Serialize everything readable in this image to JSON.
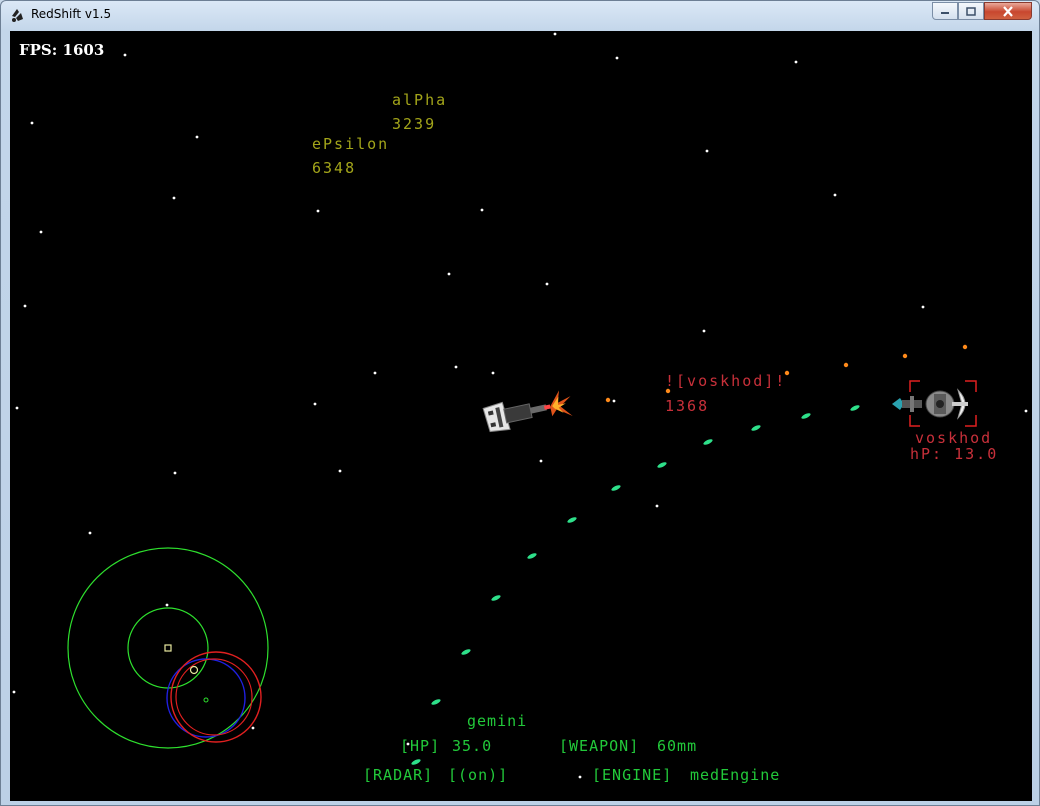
{
  "window": {
    "title": "RedShift v1.5"
  },
  "hud": {
    "fps_label": "FPS: 1603",
    "planets": [
      {
        "name": "alPha",
        "distance": "3239"
      },
      {
        "name": "ePsilon",
        "distance": "6348"
      }
    ],
    "target": {
      "label": "![voskhod]!",
      "distance": "1368",
      "name": "voskhod",
      "hp_label": "hP: 13.0"
    },
    "player": {
      "ship_name": "gemini",
      "hp_label": "[HP]",
      "hp_value": "35.0",
      "weapon_label": "[WEAPON]",
      "weapon_value": "60mm",
      "radar_label": "[RADAR]",
      "radar_value": "[(on)]",
      "engine_label": "[ENGINE]",
      "engine_value": "medEngine"
    }
  },
  "colors": {
    "background": "#000000",
    "stars": "#ffffff",
    "planet_text": "#a3a51a",
    "enemy_text": "#c8303a",
    "player_text": "#22c93a",
    "projectile": "#2ee08a",
    "radar_rings": "#2ee02e",
    "radar_enemy_ring": "#e02020",
    "radar_blue_ring": "#2020e0"
  },
  "icons": {
    "app": "redshift-app-icon",
    "player_ship": "player-ship-gemini",
    "enemy_ship": "enemy-ship-voskhod",
    "target_reticle": "target-reticle-icon"
  }
}
